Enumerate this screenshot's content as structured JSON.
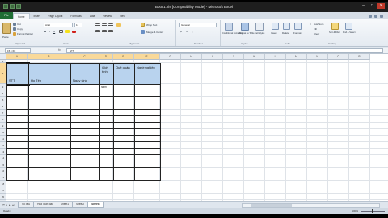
{
  "window": {
    "title": "Book1.xls [Compatibility Mode] - Microsoft Excel"
  },
  "tabs": [
    "File",
    "Home",
    "Insert",
    "Page Layout",
    "Formulas",
    "Data",
    "Review",
    "View"
  ],
  "active_tab": "Home",
  "ribbon": {
    "clipboard_label": "Clipboard",
    "cut": "Cut",
    "copy": "Copy",
    "format_painter": "Format Painter",
    "paste": "Paste",
    "font_label": "Font",
    "font_name": "Arial",
    "font_size": "11",
    "alignment_label": "Alignment",
    "wrap_text": "Wrap Text",
    "merge_center": "Merge & Center",
    "number_label": "Number",
    "number_format": "General",
    "styles_label": "Styles",
    "conditional_formatting": "Conditional Formatting",
    "format_as_table": "Format as Table",
    "cell_styles": "Cell Styles",
    "cells_label": "Cells",
    "insert": "Insert",
    "delete": "Delete",
    "format": "Format",
    "editing_label": "Editing",
    "autosum": "AutoSum",
    "fill": "Fill",
    "clear": "Clear",
    "sort_filter": "Sort & Filter",
    "find_select": "Find & Select"
  },
  "formula_bar": {
    "name_box": "15 x 6C",
    "fx": "fx",
    "value": "STT"
  },
  "columns": [
    "A",
    "B",
    "C",
    "D",
    "E",
    "F",
    "G",
    "H",
    "I",
    "J",
    "K",
    "L",
    "M",
    "N",
    "O",
    "P"
  ],
  "rows": [
    "1",
    "2",
    "3",
    "4",
    "5",
    "6",
    "7",
    "8",
    "9",
    "10",
    "11",
    "12",
    "13",
    "14",
    "15",
    "16",
    "17",
    "18",
    "19",
    "20",
    "21",
    "22"
  ],
  "table": {
    "headers": [
      "STT",
      "Họ Tên",
      "Ngày sinh",
      "Giới tính",
      "Quê quán",
      "Nghề nghiệp"
    ],
    "first_row": [
      "",
      "",
      "",
      "Nam",
      "",
      ""
    ]
  },
  "sheets": [
    "Sổ đầu",
    "Hóa Toán đầu",
    "Sheet1",
    "Sheet2",
    "Sheet3"
  ],
  "active_sheet": "Sheet3",
  "status": {
    "left": "Ready",
    "zoom": "100%"
  }
}
